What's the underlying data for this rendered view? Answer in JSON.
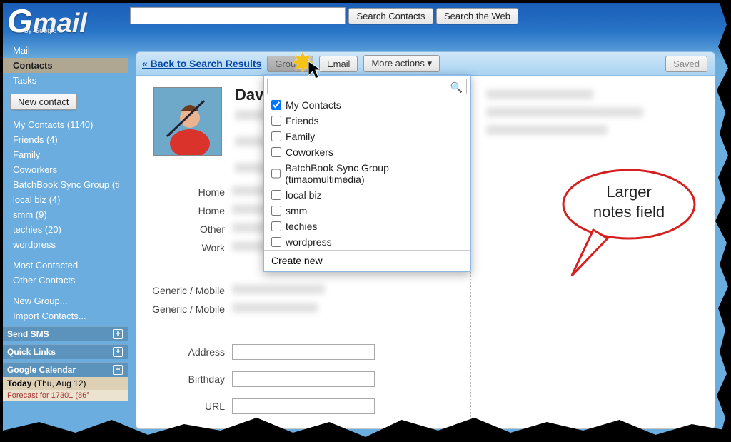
{
  "logo": {
    "letter_g": "G",
    "letter_m": "mail",
    "byline": "by Google"
  },
  "search": {
    "query": "",
    "search_contacts": "Search Contacts",
    "search_web": "Search the Web"
  },
  "nav": {
    "mail": "Mail",
    "contacts": "Contacts",
    "tasks": "Tasks",
    "new_contact": "New contact",
    "items": [
      "My Contacts (1140)",
      "Friends (4)",
      "Family",
      "Coworkers",
      "BatchBook Sync Group (ti",
      "local biz (4)",
      "smm (9)",
      "techies (20)",
      "wordpress"
    ],
    "most_contacted": "Most Contacted",
    "other_contacts": "Other Contacts",
    "new_group": "New Group...",
    "import_contacts": "Import Contacts..."
  },
  "side_sections": {
    "send_sms": "Send SMS",
    "quick_links": "Quick Links",
    "google_calendar": "Google Calendar",
    "today_label": "Today",
    "today_date": "(Thu, Aug 12)",
    "forecast": "Forecast for 17301 (86°"
  },
  "toolbar": {
    "back": "« Back to Search Results",
    "groups": "Groups",
    "email": "Email",
    "more_actions": "More actions ▾",
    "saved": "Saved"
  },
  "groups_dropdown": {
    "options": [
      {
        "label": "My Contacts",
        "checked": true
      },
      {
        "label": "Friends",
        "checked": false
      },
      {
        "label": "Family",
        "checked": false
      },
      {
        "label": "Coworkers",
        "checked": false
      },
      {
        "label": "BatchBook Sync Group (timaomultimedia)",
        "checked": false
      },
      {
        "label": "local biz",
        "checked": false
      },
      {
        "label": "smm",
        "checked": false
      },
      {
        "label": "techies",
        "checked": false
      },
      {
        "label": "wordpress",
        "checked": false
      }
    ],
    "create_new": "Create new"
  },
  "contact": {
    "name": "Dav",
    "field_labels": {
      "home": "Home",
      "other": "Other",
      "work": "Work",
      "generic_mobile": "Generic / Mobile",
      "address": "Address",
      "birthday": "Birthday",
      "url": "URL"
    }
  },
  "callout": {
    "line1": "Larger",
    "line2": "notes field"
  }
}
